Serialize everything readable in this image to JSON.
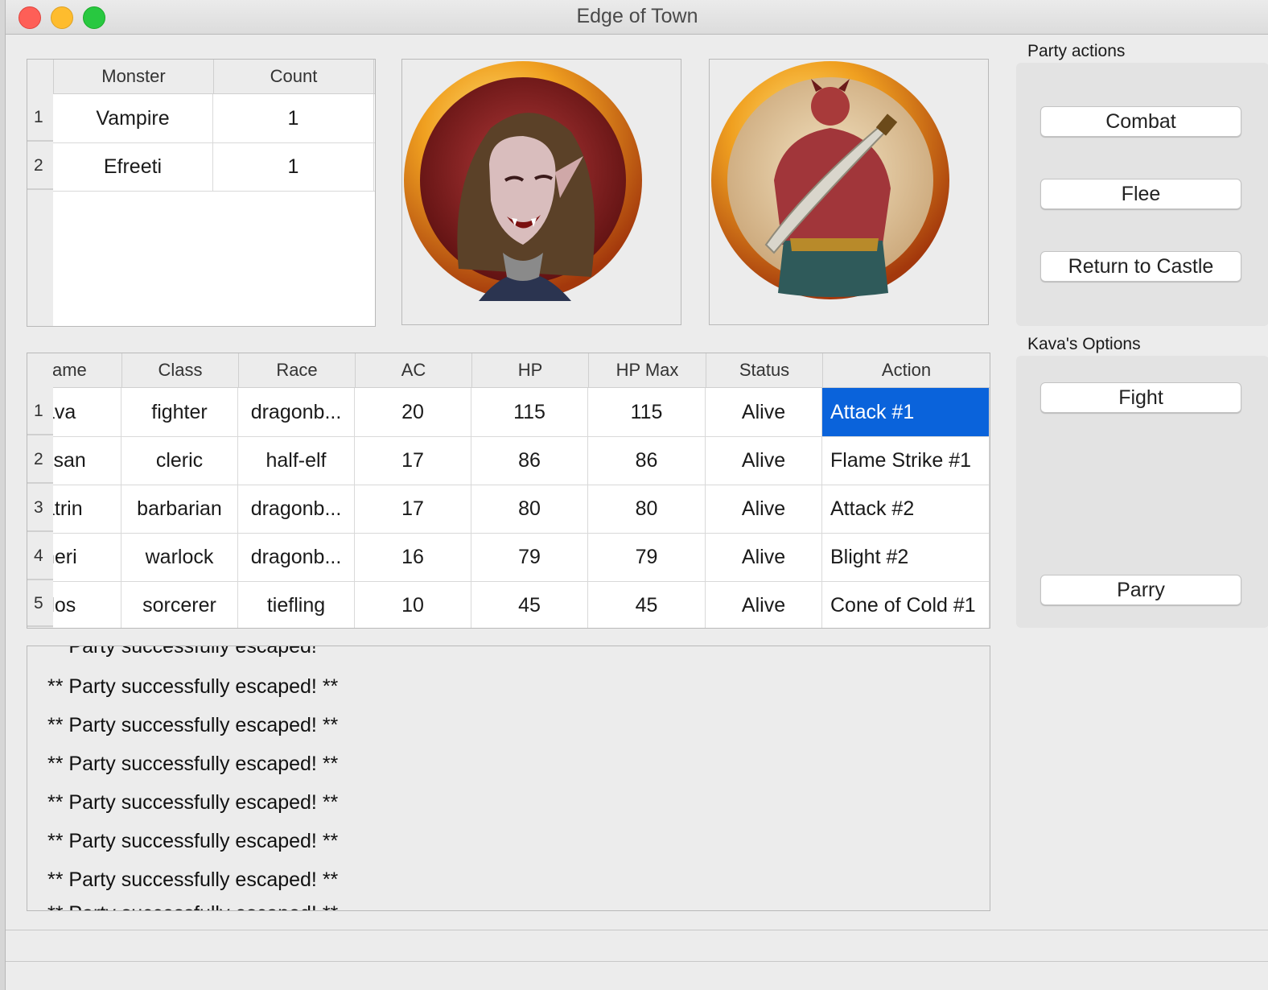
{
  "window": {
    "title": "Edge of Town"
  },
  "monster_table": {
    "headers": [
      "Monster",
      "Count"
    ],
    "rows": [
      {
        "num": "1",
        "monster": "Vampire",
        "count": "1"
      },
      {
        "num": "2",
        "monster": "Efreeti",
        "count": "1"
      }
    ]
  },
  "portraits": [
    {
      "subject": "vampire-portrait-icon"
    },
    {
      "subject": "efreeti-portrait-icon"
    }
  ],
  "party_actions": {
    "label": "Party actions",
    "buttons": [
      "Combat",
      "Flee",
      "Return to Castle"
    ]
  },
  "character_options": {
    "label": "Kava's Options",
    "buttons": [
      "Fight",
      "Parry"
    ]
  },
  "party_table": {
    "headers": [
      "ame",
      "Class",
      "Race",
      "AC",
      "HP",
      "HP Max",
      "Status",
      "Action"
    ],
    "rows": [
      {
        "num": "1",
        "name": "ava",
        "class": "fighter",
        "race": "dragonb...",
        "ac": "20",
        "hp": "115",
        "hp_max": "115",
        "status": "Alive",
        "action": "Attack #1"
      },
      {
        "num": "2",
        "name": "ssan",
        "class": "cleric",
        "race": "half-elf",
        "ac": "17",
        "hp": "86",
        "hp_max": "86",
        "status": "Alive",
        "action": "Flame Strike #1"
      },
      {
        "num": "3",
        "name": "atrin",
        "class": "barbarian",
        "race": "dragonb...",
        "ac": "17",
        "hp": "80",
        "hp_max": "80",
        "status": "Alive",
        "action": "Attack #2"
      },
      {
        "num": "4",
        "name": "neri",
        "class": "warlock",
        "race": "dragonb...",
        "ac": "16",
        "hp": "79",
        "hp_max": "79",
        "status": "Alive",
        "action": "Blight #2"
      },
      {
        "num": "5",
        "name": "dos",
        "class": "sorcerer",
        "race": "tiefling",
        "ac": "10",
        "hp": "45",
        "hp_max": "45",
        "status": "Alive",
        "action": "Cone of Cold #1"
      }
    ],
    "selected_cell": {
      "row": 0,
      "column": "action"
    },
    "selection_color": "#0a63db"
  },
  "log": {
    "lines": [
      "** Party successfully escaped! **",
      "** Party successfully escaped! **",
      "** Party successfully escaped! **",
      "** Party successfully escaped! **",
      "** Party successfully escaped! **",
      "** Party successfully escaped! **",
      "** Party successfully escaped! **",
      "** Party successfully escaped! **"
    ]
  }
}
